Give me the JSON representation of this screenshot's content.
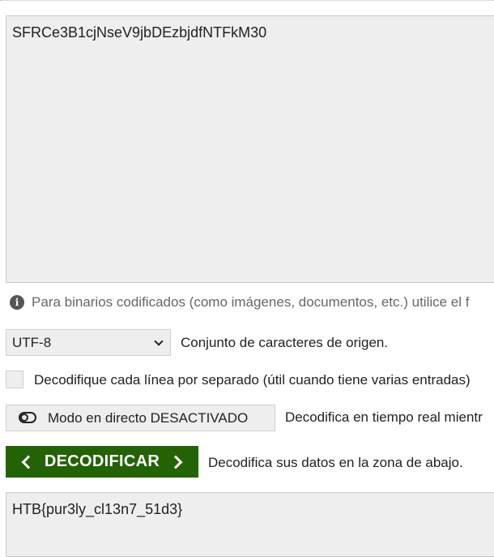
{
  "input": {
    "text": "SFRCe3B1cjNseV9jbDEzbjdfNTFkM30"
  },
  "info": {
    "text": "Para binarios codificados (como imágenes, documentos, etc.) utilice el f"
  },
  "charset": {
    "selected": "UTF-8",
    "description": "Conjunto de caracteres de origen."
  },
  "line_by_line": {
    "label": "Decodifique cada línea por separado (útil cuando tiene varias entradas)"
  },
  "live_mode": {
    "label": "Modo en directo DESACTIVADO",
    "description": "Decodifica en tiempo real mientr"
  },
  "decode": {
    "label": "DECODIFICAR",
    "description": "Decodifica sus datos en la zona de abajo.",
    "button_color": "#236205"
  },
  "output": {
    "text": "HTB{pur3ly_cl13n7_51d3}"
  }
}
